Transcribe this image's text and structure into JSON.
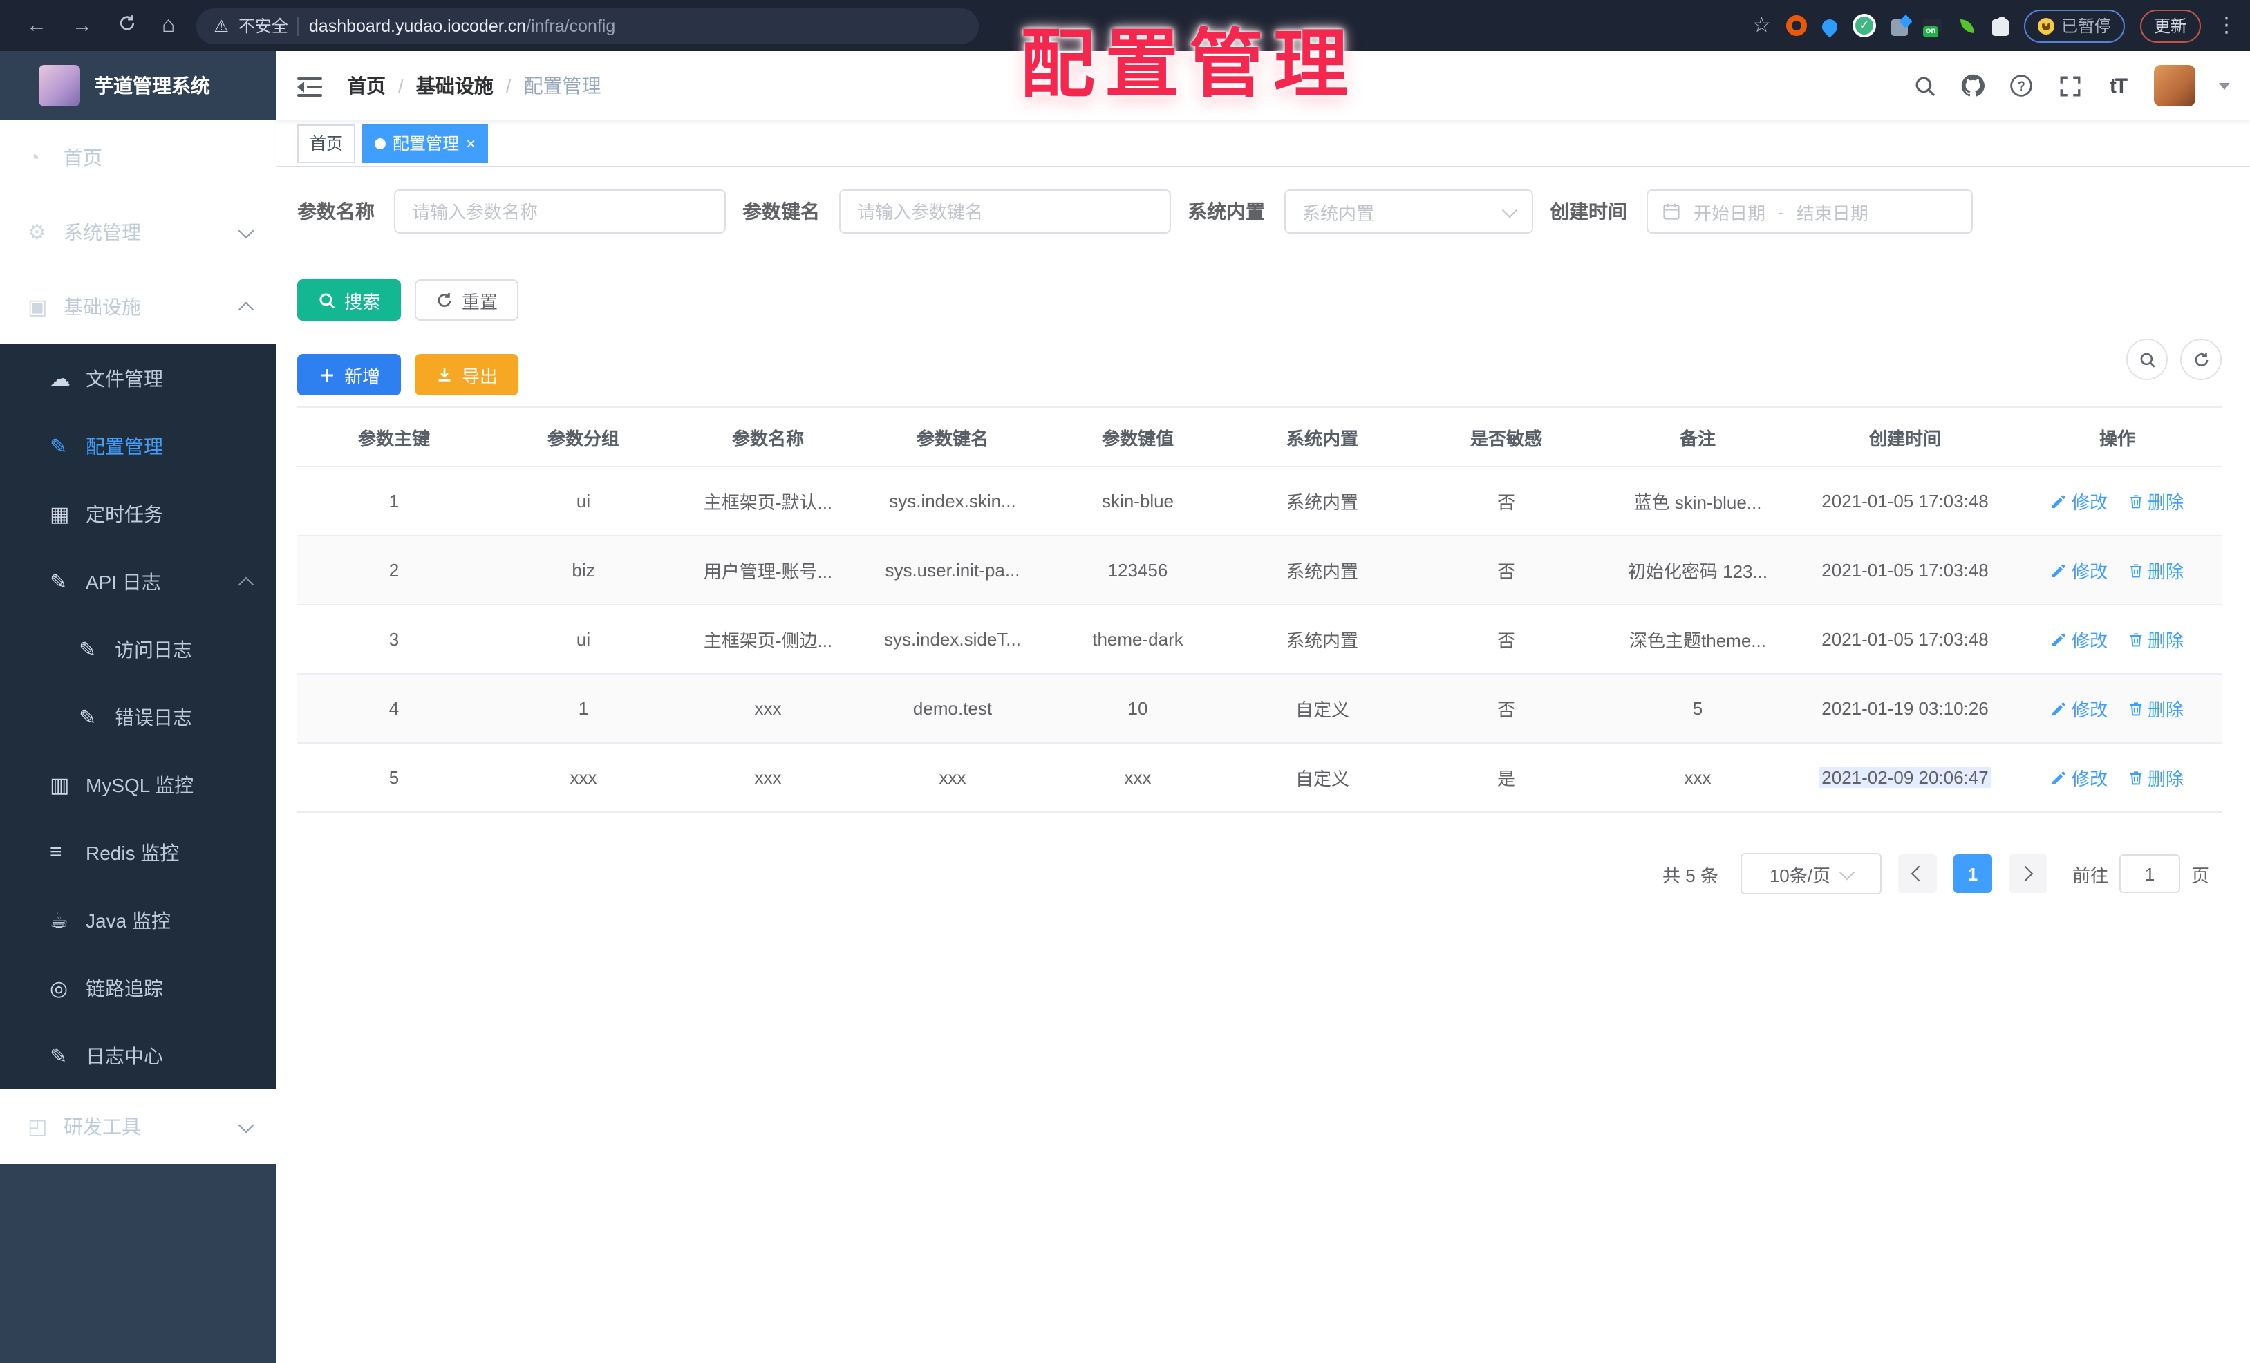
{
  "browser": {
    "security_label": "不安全",
    "host": "dashboard.yudao.iocoder.cn",
    "path": "/infra/config",
    "on_badge": "on",
    "paused_label": "已暂停",
    "update_label": "更新"
  },
  "annotation": {
    "text": "配置管理"
  },
  "sidebar": {
    "title": "芋道管理系统",
    "groups": [
      {
        "type": "main",
        "items": [
          {
            "name": "home",
            "label": "首页",
            "icon": "dashboard-icon",
            "level": 1
          },
          {
            "name": "system",
            "label": "系统管理",
            "icon": "gear-icon",
            "level": 1,
            "chevron": "down"
          },
          {
            "name": "infra",
            "label": "基础设施",
            "icon": "monitor-icon",
            "level": 1,
            "chevron": "up"
          }
        ]
      },
      {
        "type": "sub",
        "items": [
          {
            "name": "file",
            "label": "文件管理",
            "icon": "cloud-upload-icon",
            "level": 2
          },
          {
            "name": "config",
            "label": "配置管理",
            "icon": "edit-icon",
            "level": 2,
            "active": true
          },
          {
            "name": "job",
            "label": "定时任务",
            "icon": "schedule-icon",
            "level": 2
          },
          {
            "name": "api-log",
            "label": "API 日志",
            "icon": "log-icon",
            "level": 2,
            "chevron": "up"
          },
          {
            "name": "access-log",
            "label": "访问日志",
            "icon": "log-icon",
            "level": 3
          },
          {
            "name": "error-log",
            "label": "错误日志",
            "icon": "log-icon",
            "level": 3
          },
          {
            "name": "mysql",
            "label": "MySQL 监控",
            "icon": "mysql-icon",
            "level": 2
          },
          {
            "name": "redis",
            "label": "Redis 监控",
            "icon": "redis-icon",
            "level": 2
          },
          {
            "name": "java",
            "label": "Java 监控",
            "icon": "java-icon",
            "level": 2
          },
          {
            "name": "trace",
            "label": "链路追踪",
            "icon": "eye-icon",
            "level": 2
          },
          {
            "name": "log-center",
            "label": "日志中心",
            "icon": "log-icon",
            "level": 2
          }
        ]
      },
      {
        "type": "main",
        "items": [
          {
            "name": "devtools",
            "label": "研发工具",
            "icon": "devtools-icon",
            "level": 1,
            "chevron": "down"
          }
        ]
      }
    ]
  },
  "breadcrumb": {
    "sep": "/",
    "items": [
      "首页",
      "基础设施",
      "配置管理"
    ]
  },
  "tags": [
    {
      "label": "首页",
      "active": false
    },
    {
      "label": "配置管理",
      "active": true
    }
  ],
  "header_icons": {
    "font_size_glyph": "tT"
  },
  "filters": {
    "name_label": "参数名称",
    "name_placeholder": "请输入参数名称",
    "key_label": "参数键名",
    "key_placeholder": "请输入参数键名",
    "type_label": "系统内置",
    "type_placeholder": "系统内置",
    "date_label": "创建时间",
    "date_start": "开始日期",
    "date_sep": "-",
    "date_end": "结束日期",
    "search_label": "搜索",
    "reset_label": "重置",
    "add_label": "新增",
    "export_label": "导出"
  },
  "table": {
    "headers": [
      "参数主键",
      "参数分组",
      "参数名称",
      "参数键名",
      "参数键值",
      "系统内置",
      "是否敏感",
      "备注",
      "创建时间",
      "操作"
    ],
    "rows": [
      {
        "cells": [
          "1",
          "ui",
          "主框架页-默认...",
          "sys.index.skin...",
          "skin-blue",
          "系统内置",
          "否",
          "蓝色 skin-blue...",
          "2021-01-05 17:03:48"
        ]
      },
      {
        "cells": [
          "2",
          "biz",
          "用户管理-账号...",
          "sys.user.init-pa...",
          "123456",
          "系统内置",
          "否",
          "初始化密码 123...",
          "2021-01-05 17:03:48"
        ]
      },
      {
        "cells": [
          "3",
          "ui",
          "主框架页-侧边...",
          "sys.index.sideT...",
          "theme-dark",
          "系统内置",
          "否",
          "深色主题theme...",
          "2021-01-05 17:03:48"
        ]
      },
      {
        "cells": [
          "4",
          "1",
          "xxx",
          "demo.test",
          "10",
          "自定义",
          "否",
          "5",
          "2021-01-19 03:10:26"
        ]
      },
      {
        "cells": [
          "5",
          "xxx",
          "xxx",
          "xxx",
          "xxx",
          "自定义",
          "是",
          "xxx",
          "2021-02-09 20:06:47"
        ],
        "time_selected": true
      }
    ]
  },
  "row_actions": {
    "edit": "修改",
    "delete": "删除"
  },
  "pagination": {
    "total": "共 5 条",
    "page_size": "10条/页",
    "current_page": "1",
    "goto_label": "前往",
    "goto_value": "1",
    "page_unit": "页"
  }
}
